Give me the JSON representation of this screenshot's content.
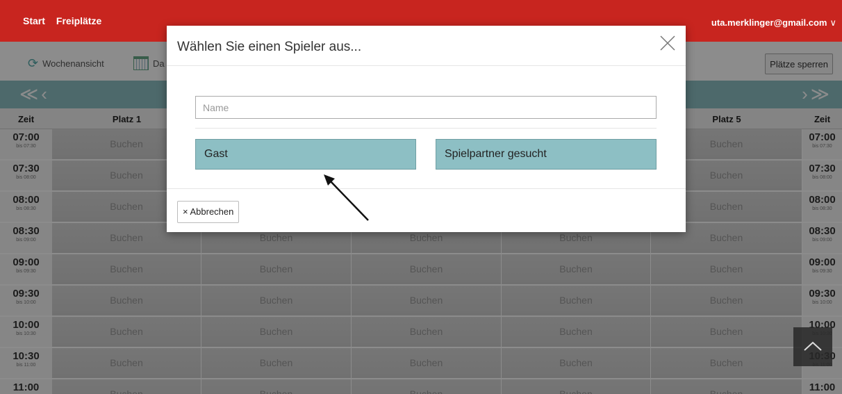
{
  "nav": {
    "start": "Start",
    "free": "Freiplätze",
    "user": "uta.merklinger@gmail.com",
    "user_chevron": "∨"
  },
  "toolbar": {
    "week": "Wochenansicht",
    "date": "Da",
    "lock": "Plätze sperren"
  },
  "schedule_nav": {
    "left": "≪‹",
    "right": "›≫"
  },
  "headers": {
    "time": "Zeit",
    "court1": "Platz 1",
    "court5": "Platz 5",
    "time_right": "Zeit"
  },
  "rows": [
    {
      "t": "07:00",
      "s": "bis 07:30"
    },
    {
      "t": "07:30",
      "s": "bis 08:00"
    },
    {
      "t": "08:00",
      "s": "bis 08:30"
    },
    {
      "t": "08:30",
      "s": "bis 09:00"
    },
    {
      "t": "09:00",
      "s": "bis 09:30"
    },
    {
      "t": "09:30",
      "s": "bis 10:00"
    },
    {
      "t": "10:00",
      "s": "bis 10:30"
    },
    {
      "t": "10:30",
      "s": "bis 11:00"
    },
    {
      "t": "11:00",
      "s": ""
    }
  ],
  "book_label": "Buchen",
  "modal": {
    "title": "Wählen Sie einen Spieler aus...",
    "name_placeholder": "Name",
    "guest": "Gast",
    "partner": "Spielpartner gesucht",
    "cancel": "× Abbrechen"
  },
  "colors": {
    "brand": "#c8251f",
    "teal": "#8dbfc4"
  }
}
